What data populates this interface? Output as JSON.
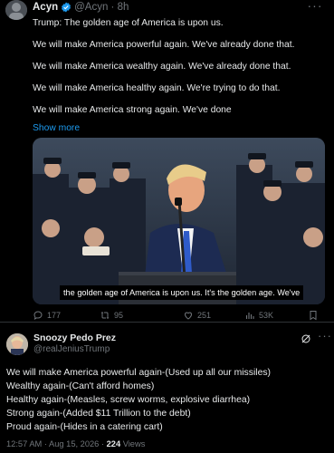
{
  "quoted_post": {
    "author_name": "Acyn",
    "author_handle": "@Acyn · 8h",
    "lines": [
      "Trump: The golden age of America is upon us.",
      "",
      "We will make America powerful again. We've already done that.",
      "",
      "We will make America wealthy again. We've already done that.",
      "",
      "We will make America healthy again. We're trying to do that.",
      "",
      "We will make America strong again. We've done"
    ],
    "show_more": "Show more",
    "video_subtitle": "the golden age of America is upon us. It's the golden age. We've",
    "stats": {
      "replies": "177",
      "reposts": "95",
      "likes": "251",
      "views": "53K"
    }
  },
  "reply_post": {
    "author_name": "Snoozy Pedo Prez",
    "author_handle": "@realJeniusTrump",
    "lines": [
      "We will make America powerful again-(Used up all our missiles)",
      "Wealthy again-(Can't afford homes)",
      "Healthy again-(Measles, screw worms, explosive diarrhea)",
      "Strong again-(Added $11 Trillion to the debt)",
      "Proud again-(Hides in a catering cart)"
    ],
    "timestamp": "12:57 AM · Aug 15, 2026 · ",
    "views_count": "224",
    "views_label": " Views"
  },
  "colors": {
    "background": "#000000",
    "text": "#e7e9ea",
    "muted": "#71767b",
    "link": "#1d9bf0",
    "border": "#2f3336"
  },
  "icons": [
    "verified-badge-icon",
    "more-icon",
    "reply-icon",
    "repost-icon",
    "like-icon",
    "views-icon",
    "bookmark-icon",
    "grok-icon"
  ]
}
